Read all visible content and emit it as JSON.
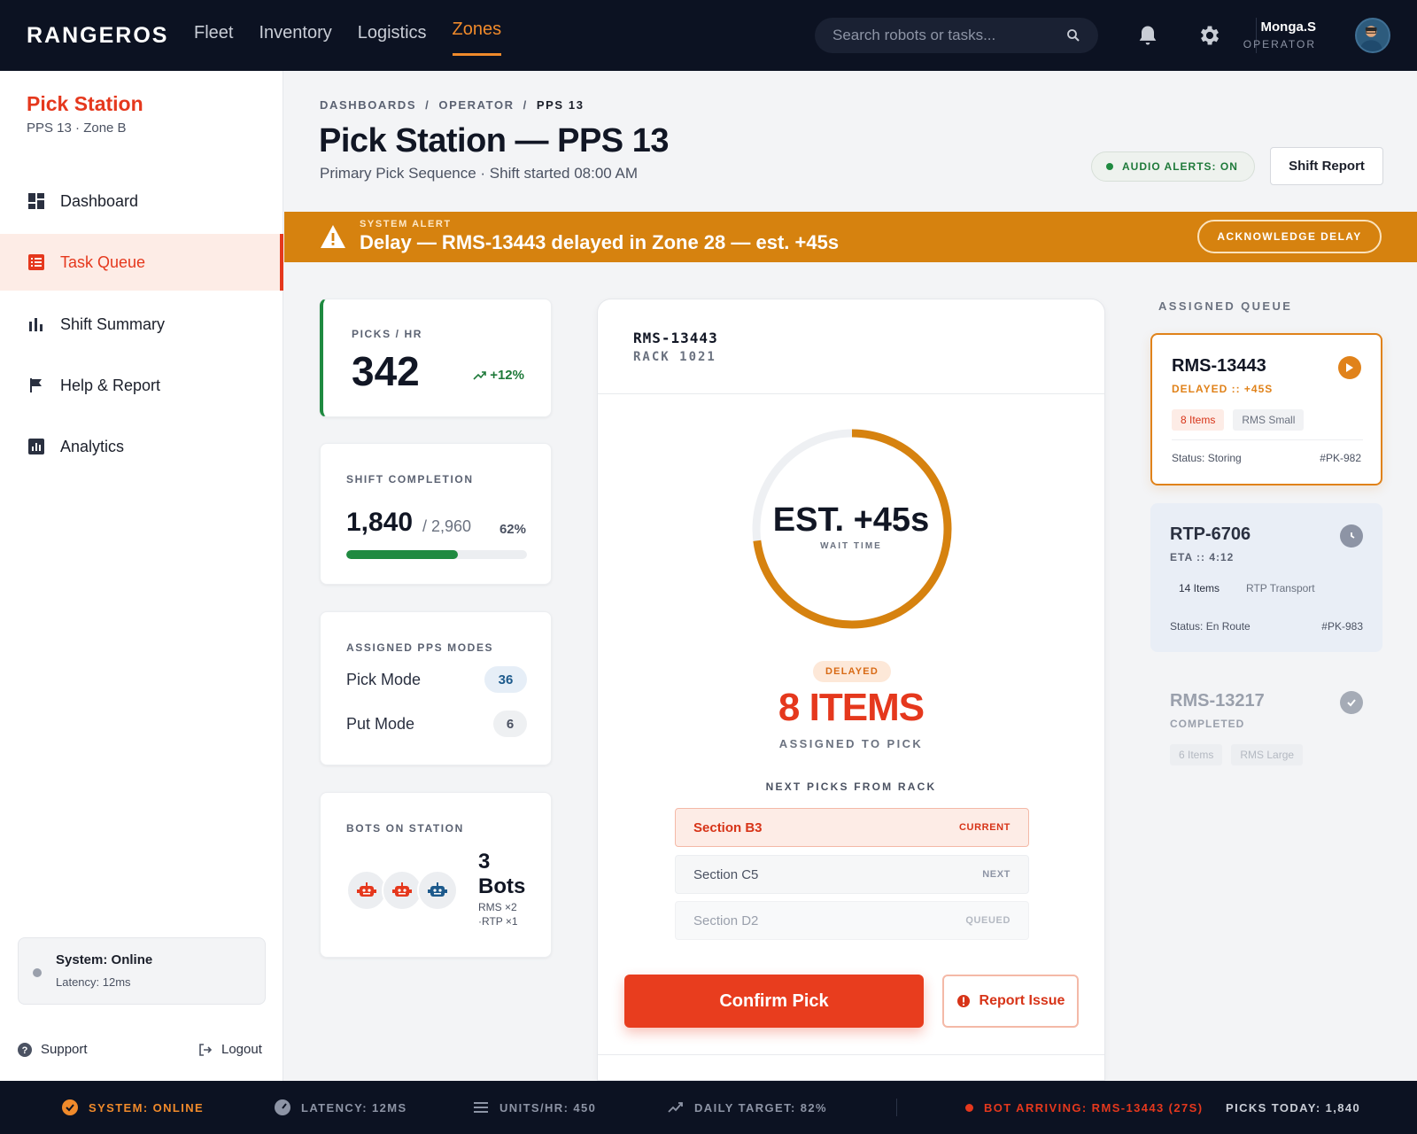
{
  "topnav": {
    "brand": "RANGEROS",
    "links": [
      "Fleet",
      "Inventory",
      "Logistics",
      "Zones"
    ],
    "active_link": "Zones",
    "search_placeholder": "Search robots or tasks...",
    "user_name": "Monga.S",
    "user_role": "OPERATOR"
  },
  "sidebar": {
    "title": "Pick Station",
    "subtitle": "PPS 13 · Zone B",
    "items": [
      {
        "label": "Dashboard",
        "icon": "dashboard-icon"
      },
      {
        "label": "Task Queue",
        "icon": "list-icon",
        "active": true
      },
      {
        "label": "Shift Summary",
        "icon": "bar-chart-icon"
      },
      {
        "label": "Help & Report",
        "icon": "flag-icon"
      },
      {
        "label": "Analytics",
        "icon": "analytics-icon"
      }
    ],
    "system_title": "System: Online",
    "system_latency": "Latency: 12ms",
    "support_label": "Support",
    "logout_label": "Logout"
  },
  "header": {
    "breadcrumbs": [
      "DASHBOARDS",
      "/",
      "OPERATOR",
      "/",
      "PPS 13"
    ],
    "title": "Pick Station — PPS 13",
    "subtitle": "Primary Pick Sequence · Shift started 08:00 AM",
    "audio_label": "AUDIO ALERTS: ON",
    "shift_report_label": "Shift Report"
  },
  "alert": {
    "tag": "SYSTEM ALERT",
    "message": "Delay — RMS-13443 delayed in Zone 28 — est. +45s",
    "action_label": "ACKNOWLEDGE DELAY"
  },
  "stats": {
    "picks_label": "PICKS / HR",
    "picks_value": "342",
    "picks_trend": "+12%",
    "completion_label": "SHIFT COMPLETION",
    "completion_value": "1,840",
    "completion_total": "/ 2,960",
    "completion_pct": "62%",
    "completion_fraction": 0.62,
    "modes_label": "ASSIGNED PPS MODES",
    "modes": [
      {
        "label": "Pick Mode",
        "count": "36"
      },
      {
        "label": "Put Mode",
        "count": "6"
      }
    ],
    "bots_label": "BOTS ON STATION",
    "bots_count": "3",
    "bots_unit": "Bots",
    "bots_mix_1": "RMS ×2",
    "bots_mix_2": "·RTP ×1"
  },
  "task": {
    "robot_id": "RMS-13443",
    "rack": "RACK 1021",
    "wait_value": "EST. +45s",
    "wait_label": "WAIT TIME",
    "wait_progress": 0.73,
    "status_badge": "DELAYED",
    "items_count": "8 ITEMS",
    "items_sub": "ASSIGNED TO PICK",
    "next_label": "NEXT PICKS FROM RACK",
    "sections": [
      {
        "name": "Section B3",
        "state": "CURRENT"
      },
      {
        "name": "Section C5",
        "state": "NEXT"
      },
      {
        "name": "Section D2",
        "state": "QUEUED"
      }
    ],
    "confirm_label": "Confirm Pick",
    "report_label": "Report Issue"
  },
  "queue": {
    "label": "ASSIGNED QUEUE",
    "cards": [
      {
        "id": "RMS-13443",
        "status": "DELAYED :: +45S",
        "tags": [
          "8 Items",
          "RMS Small"
        ],
        "foot_status": "Status: Storing",
        "ref": "#PK-982"
      },
      {
        "id": "RTP-6706",
        "status": "ETA :: 4:12",
        "tags": [
          "14 Items",
          "RTP Transport"
        ],
        "foot_status": "Status: En Route",
        "ref": "#PK-983"
      },
      {
        "id": "RMS-13217",
        "status": "COMPLETED",
        "tags": [
          "6 Items",
          "RMS Large"
        ]
      }
    ]
  },
  "statusbar": {
    "system": "SYSTEM: ONLINE",
    "latency": "LATENCY: 12MS",
    "units": "UNITS/HR: 450",
    "target": "DAILY TARGET: 82%",
    "arriving": "BOT ARRIVING: RMS-13443 (27S)",
    "picks_today": "PICKS TODAY: 1,840"
  },
  "colors": {
    "accent": "#e5381d",
    "warning": "#d6820f",
    "success": "#1f8a40",
    "nav_bg": "#0c1222"
  }
}
